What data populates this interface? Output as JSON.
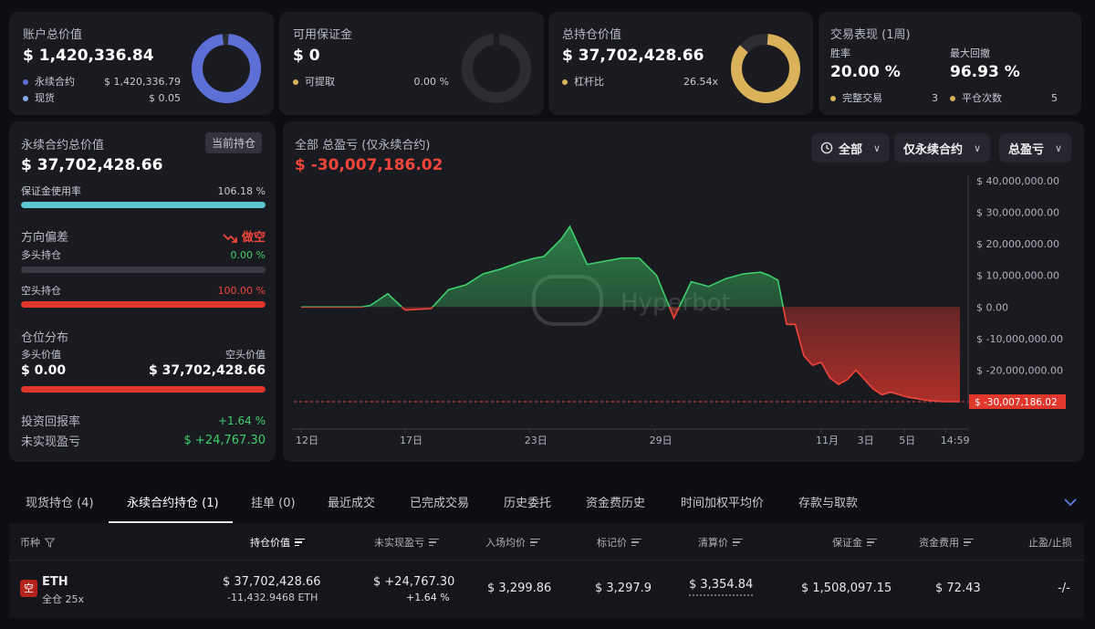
{
  "summary": {
    "account": {
      "title": "账户总价值",
      "value": "$ 1,420,336.84",
      "rows": [
        {
          "label": "永续合约",
          "value": "$ 1,420,336.79",
          "color": "#5b6fd6"
        },
        {
          "label": "现货",
          "value": "$ 0.05",
          "color": "#8aa8e8"
        }
      ],
      "ring_fraction": 0.999,
      "ring_color": "#5b6fd6"
    },
    "margin": {
      "title": "可用保证金",
      "value": "$ 0",
      "rows": [
        {
          "label": "可提取",
          "value": "0.00 %",
          "color": "#d9b25a"
        }
      ],
      "ring_fraction": 0,
      "ring_color": "#d9b25a"
    },
    "position": {
      "title": "总持仓价值",
      "value": "$ 37,702,428.66",
      "rows": [
        {
          "label": "杠杆比",
          "value": "26.54x",
          "color": "#d9b25a"
        }
      ],
      "ring_fraction": 0.885,
      "ring_color": "#d9b25a"
    },
    "performance": {
      "title": "交易表现 (1周)",
      "winrate_label": "胜率",
      "winrate": "20.00 %",
      "drawdown_label": "最大回撤",
      "drawdown": "96.93 %",
      "trades_label": "完整交易",
      "trades": "3",
      "close_label": "平仓次数",
      "close_count": "5",
      "dot_color": "#d9b25a"
    }
  },
  "perp": {
    "title": "永续合约总价值",
    "badge": "当前持仓",
    "value": "$ 37,702,428.66",
    "margin_usage_label": "保证金使用率",
    "margin_usage": "106.18 %",
    "margin_usage_fraction": 1.0,
    "bias_label": "方向偏差",
    "bias": "做空",
    "long_label": "多头持仓",
    "long_pct": "0.00 %",
    "long_fraction": 0,
    "short_label": "空头持仓",
    "short_pct": "100.00 %",
    "short_fraction": 1.0,
    "dist_label": "仓位分布",
    "long_value_label": "多头价值",
    "short_value_label": "空头价值",
    "long_value": "$ 0.00",
    "short_value": "$ 37,702,428.66",
    "roi_label": "投资回报率",
    "roi": "+1.64 %",
    "upnl_label": "未实现盈亏",
    "upnl": "$ +24,767.30"
  },
  "chart_header": {
    "title": "全部 总盈亏 (仅永续合约)",
    "value": "$ -30,007,186.02",
    "filter_all": "全部",
    "filter_perp": "仅永续合约",
    "filter_pnl": "总盈亏",
    "watermark": "Hyperbot"
  },
  "chart_data": {
    "type": "area",
    "title": "全部 总盈亏 (仅永续合约)",
    "x_ticks": [
      {
        "label": "12日",
        "pos": 0
      },
      {
        "label": "17日",
        "pos": 5
      },
      {
        "label": "23日",
        "pos": 11
      },
      {
        "label": "29日",
        "pos": 17
      },
      {
        "label": "11月",
        "pos": 25
      },
      {
        "label": "3日",
        "pos": 27
      },
      {
        "label": "5日",
        "pos": 29
      },
      {
        "label": "14:59",
        "pos": 31
      }
    ],
    "y_ticks": [
      "$ 40,000,000.00",
      "$ 30,000,000.00",
      "$ 20,000,000.00",
      "$ 10,000,000.00",
      "$ 0.00",
      "$ -10,000,000.00",
      "$ -20,000,000.00"
    ],
    "ylim": [
      -30007186.02,
      40000000
    ],
    "current_label": "$ -30,007,186.02",
    "series": [
      {
        "points": [
          [
            0,
            0
          ],
          [
            3.5,
            0
          ],
          [
            4,
            500000
          ],
          [
            5,
            4200000
          ],
          [
            6,
            -1000000
          ],
          [
            7.5,
            -500000
          ],
          [
            8.5,
            5500000
          ],
          [
            9.5,
            7000000
          ],
          [
            10.5,
            10500000
          ],
          [
            11.5,
            12000000
          ],
          [
            12.5,
            14000000
          ],
          [
            13.5,
            15500000
          ],
          [
            14,
            16000000
          ],
          [
            15,
            21500000
          ],
          [
            15.5,
            25500000
          ],
          [
            16.5,
            13500000
          ],
          [
            17.5,
            14500000
          ],
          [
            18.5,
            15500000
          ],
          [
            19.5,
            15500000
          ],
          [
            20.5,
            10000000
          ],
          [
            21.5,
            -3500000
          ],
          [
            22.5,
            8000000
          ],
          [
            23.5,
            6500000
          ],
          [
            24.5,
            9000000
          ],
          [
            25.5,
            10500000
          ],
          [
            26.5,
            11000000
          ],
          [
            27,
            10000000
          ],
          [
            27.5,
            8500000
          ],
          [
            28,
            -5500000
          ],
          [
            28.5,
            -5500000
          ],
          [
            29,
            -15500000
          ],
          [
            29.5,
            -18500000
          ],
          [
            30,
            -17500000
          ],
          [
            30.5,
            -22500000
          ],
          [
            31,
            -24500000
          ],
          [
            31.5,
            -23000000
          ],
          [
            32,
            -20000000
          ],
          [
            33,
            -26000000
          ],
          [
            33.5,
            -27800000
          ],
          [
            34,
            -27000000
          ],
          [
            35,
            -28600000
          ],
          [
            36,
            -29500000
          ],
          [
            37,
            -30007186.02
          ],
          [
            38,
            -30007186.02
          ]
        ]
      }
    ]
  },
  "tabs": [
    "现货持仓 (4)",
    "永续合约持仓 (1)",
    "挂单 (0)",
    "最近成交",
    "已完成交易",
    "历史委托",
    "资金费历史",
    "时间加权平均价",
    "存款与取款"
  ],
  "table": {
    "headers": [
      "币种",
      "持仓价值",
      "未实现盈亏",
      "入场均价",
      "标记价",
      "清算价",
      "保证金",
      "资金费用",
      "止盈/止损"
    ],
    "row": {
      "side": "空",
      "coin": "ETH",
      "mode": "全仓 25x",
      "value": "$ 37,702,428.66",
      "size": "-11,432.9468 ETH",
      "upnl": "$ +24,767.30",
      "upnl_pct": "+1.64 %",
      "entry": "$ 3,299.86",
      "mark": "$ 3,297.9",
      "liq": "$ 3,354.84",
      "margin": "$ 1,508,097.15",
      "funding": "$ 72.43",
      "tpsl": "-/-"
    }
  }
}
